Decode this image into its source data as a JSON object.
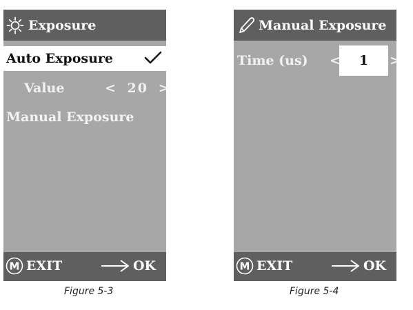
{
  "figure_left": {
    "header": {
      "icon": "sun-icon",
      "title": "Exposure"
    },
    "items": {
      "auto_exposure": "Auto Exposure",
      "auto_exposure_checked": true,
      "value_label": "Value",
      "value_prev": "<",
      "value_number": "20",
      "value_next": ">",
      "manual_exposure": "Manual Exposure"
    },
    "footer": {
      "m_icon": "M",
      "exit_label": "EXIT",
      "arrow_icon": "right-arrow-icon",
      "ok_label": "OK"
    },
    "caption": "Figure 5-3"
  },
  "figure_right": {
    "header": {
      "icon": "pencil-icon",
      "title": "Manual Exposure"
    },
    "items": {
      "time_label": "Time (us)",
      "time_prev": "<",
      "time_value": "1",
      "time_next": ">"
    },
    "footer": {
      "m_icon": "M",
      "exit_label": "EXIT",
      "arrow_icon": "right-arrow-icon",
      "ok_label": "OK"
    },
    "caption": "Figure 5-4"
  },
  "colors": {
    "screen_bg": "#a7a7a7",
    "bar_bg": "#5f5f5f",
    "selected_bg": "#ffffff",
    "text_light": "#ffffff",
    "text_dark": "#111111"
  }
}
